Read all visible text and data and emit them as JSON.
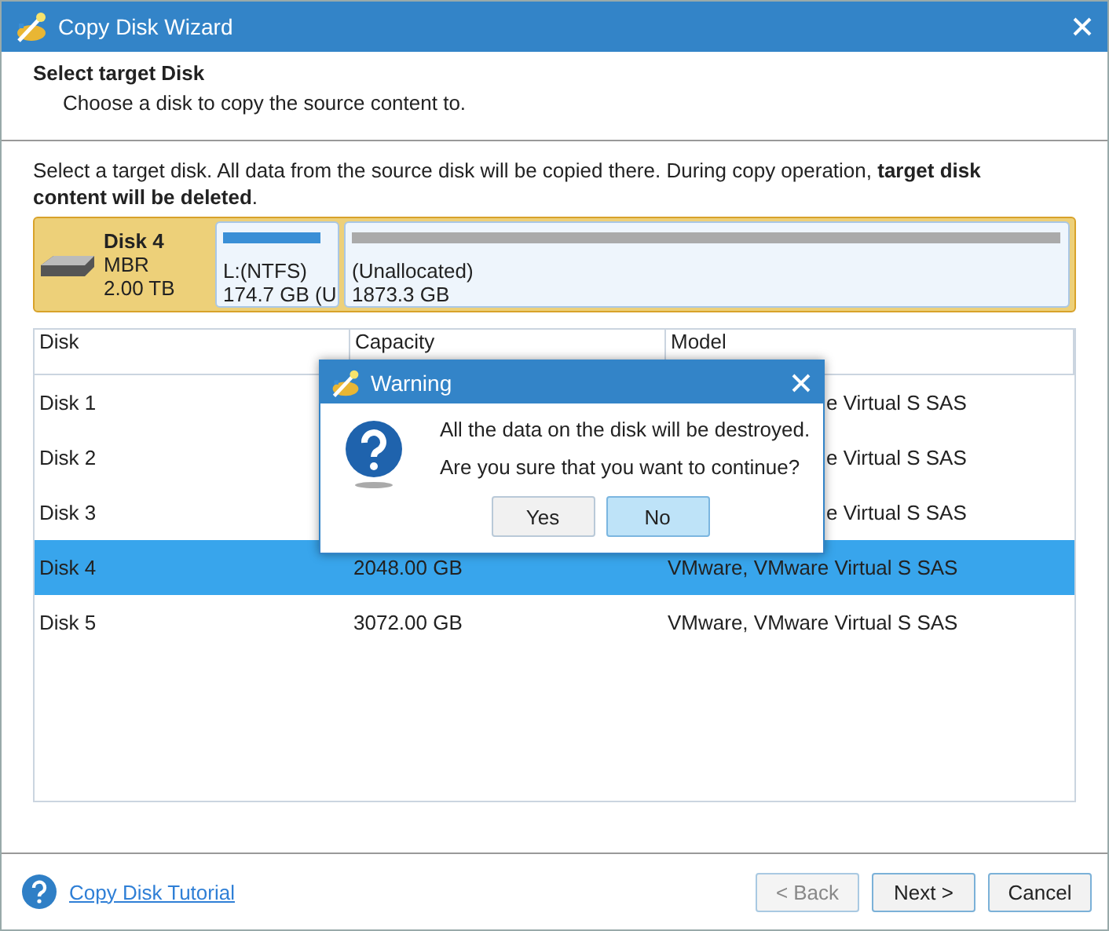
{
  "window": {
    "title": "Copy Disk Wizard"
  },
  "header": {
    "title": "Select target Disk",
    "subtitle": "Choose a disk to copy the source content to."
  },
  "instruction": "Select a target disk. All data from the source disk will be copied there. During copy operation, **target disk content will be deleted**.",
  "disk_map": {
    "name": "Disk 4",
    "type": "MBR",
    "size": "2.00 TB",
    "partitions": [
      {
        "kind": "used",
        "label": "L:(NTFS)",
        "detail": "174.7 GB (U"
      },
      {
        "kind": "unallocated",
        "label": "(Unallocated)",
        "detail": "1873.3 GB"
      }
    ]
  },
  "table": {
    "columns": [
      "Disk",
      "Capacity",
      "Model"
    ],
    "rows": [
      {
        "kind": "partly_hidden",
        "disk": "Disk 1",
        "model": "e Virtual S SAS",
        "selected": false
      },
      {
        "kind": "partly_hidden",
        "disk": "Disk 2",
        "model": "e Virtual S SAS",
        "selected": false
      },
      {
        "kind": "partly_hidden",
        "disk": "Disk 3",
        "model": "e Virtual S SAS",
        "selected": false
      },
      {
        "kind": "full",
        "disk": "Disk 4",
        "capacity": "2048.00 GB",
        "model": "VMware, VMware Virtual S SAS",
        "selected": true
      },
      {
        "kind": "full",
        "disk": "Disk 5",
        "capacity": "3072.00 GB",
        "model": "VMware, VMware Virtual S SAS",
        "selected": false
      }
    ]
  },
  "footer": {
    "link": "Copy Disk Tutorial",
    "buttons": [
      {
        "label": "< Back",
        "disabled": true
      },
      {
        "label": "Next >",
        "disabled": false
      },
      {
        "label": "Cancel",
        "disabled": false
      }
    ]
  },
  "dialog": {
    "title": "Warning",
    "lines": [
      "All the data on the disk will be destroyed.",
      "Are you sure that you want to continue?"
    ],
    "buttons": [
      {
        "label": "Yes",
        "selected": false
      },
      {
        "label": "No",
        "selected": true
      }
    ]
  }
}
